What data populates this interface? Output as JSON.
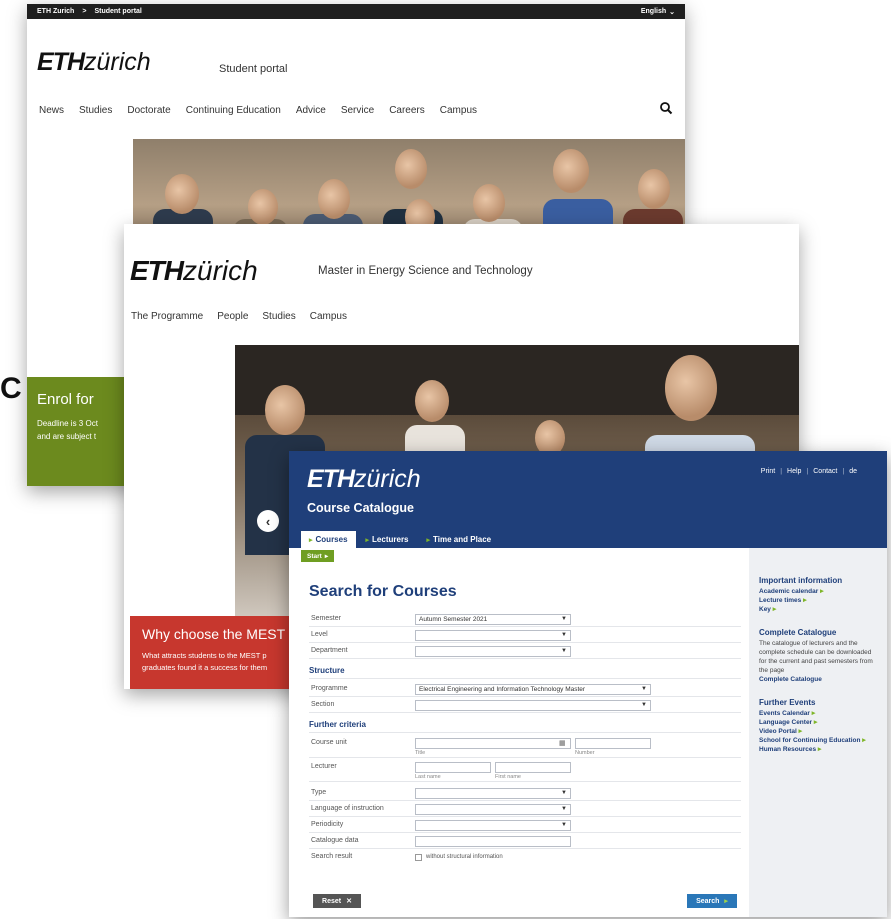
{
  "portal": {
    "breadcrumb": [
      "ETH Zurich",
      "Student portal"
    ],
    "breadcrumb_sep": ">",
    "language": "English",
    "logo_eth": "ETH",
    "logo_zurich": "zürich",
    "site_title": "Student portal",
    "nav": [
      "News",
      "Studies",
      "Doctorate",
      "Continuing Education",
      "Advice",
      "Service",
      "Careers",
      "Campus"
    ],
    "banner_title": "Enrol for ",
    "banner_text_1": "Deadline is 3 Oct",
    "banner_text_2": "and are subject t",
    "edge_letter": "C"
  },
  "mest": {
    "logo_eth": "ETH",
    "logo_zurich": "zürich",
    "site_title": "Master in Energy Science and Technology",
    "nav": [
      "The Programme",
      "People",
      "Studies",
      "Campus"
    ],
    "banner_title": "Why choose the MEST",
    "banner_text_1": "What attracts students to the MEST p",
    "banner_text_2": "graduates found it a success for them"
  },
  "catalogue": {
    "logo_eth": "ETH",
    "logo_zurich": "zürich",
    "header_title": "Course Catalogue",
    "utility_links": [
      "Print",
      "Help",
      "Contact",
      "de"
    ],
    "tabs": [
      "Courses",
      "Lecturers",
      "Time and Place"
    ],
    "start_label": "Start",
    "page_title": "Search for Courses",
    "fields": {
      "semester": {
        "label": "Semester",
        "value": "Autumn Semester 2021"
      },
      "level": {
        "label": "Level",
        "value": ""
      },
      "department": {
        "label": "Department",
        "value": ""
      }
    },
    "structure_heading": "Structure",
    "programme": {
      "label": "Programme",
      "value": "Electrical Engineering and Information Technology Master"
    },
    "section": {
      "label": "Section",
      "value": ""
    },
    "further_heading": "Further criteria",
    "course_unit": {
      "label": "Course unit",
      "sub_title": "Title",
      "sub_number": "Number"
    },
    "lecturer": {
      "label": "Lecturer",
      "sub_last": "Last name",
      "sub_first": "First name"
    },
    "type": {
      "label": "Type"
    },
    "language": {
      "label": "Language of instruction"
    },
    "periodicity": {
      "label": "Periodicity"
    },
    "catalogue_data": {
      "label": "Catalogue data"
    },
    "search_result": {
      "label": "Search result",
      "option": "without structural information"
    },
    "reset_label": "Reset",
    "search_label": "Search",
    "sidebar": {
      "important_heading": "Important information",
      "important_links": [
        "Academic calendar",
        "Lecture times",
        "Key"
      ],
      "complete_heading": "Complete Catalogue",
      "complete_text": "The catalogue of lecturers and the complete schedule can be downloaded for the current and past semesters from the page",
      "complete_link": "Complete Catalogue",
      "events_heading": "Further Events",
      "events_links": [
        "Events Calendar",
        "Language Center",
        "Video Portal",
        "School for Continuing Education",
        "Human Resources"
      ]
    }
  },
  "colors": {
    "eth_blue": "#1f3f7a",
    "green": "#6c8a1e",
    "red": "#c7372e"
  }
}
